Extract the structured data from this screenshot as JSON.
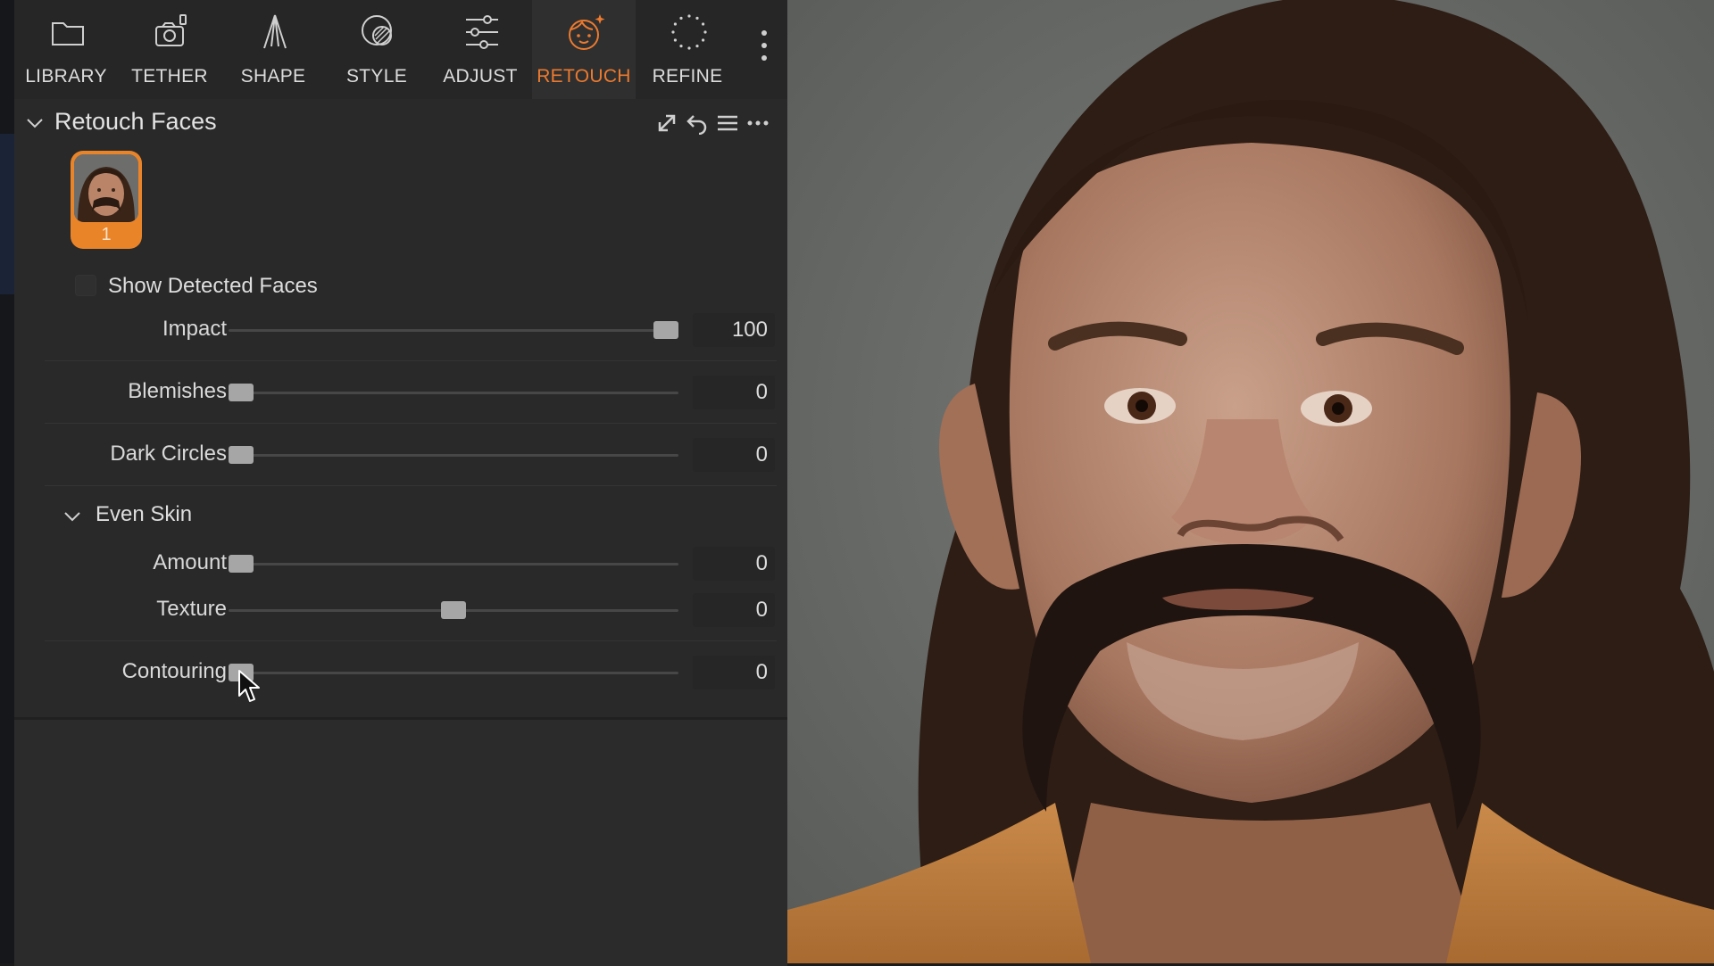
{
  "toolbar": {
    "tools": [
      {
        "label": "LIBRARY",
        "icon": "folder-icon",
        "active": false
      },
      {
        "label": "TETHER",
        "icon": "camera-icon",
        "active": false
      },
      {
        "label": "SHAPE",
        "icon": "shape-icon",
        "active": false
      },
      {
        "label": "STYLE",
        "icon": "style-icon",
        "active": false
      },
      {
        "label": "ADJUST",
        "icon": "adjust-sliders-icon",
        "active": false
      },
      {
        "label": "RETOUCH",
        "icon": "retouch-face-icon",
        "active": true
      },
      {
        "label": "REFINE",
        "icon": "refine-icon",
        "active": false
      }
    ],
    "active_color": "#ec7a2f"
  },
  "section": {
    "title": "Retouch Faces",
    "header_icons": [
      "expand-icon",
      "reset-icon",
      "list-icon",
      "more-icon"
    ]
  },
  "faces": [
    {
      "index": "1"
    }
  ],
  "show_detected_faces": {
    "label": "Show Detected Faces",
    "checked": false
  },
  "sliders": {
    "impact": {
      "label": "Impact",
      "value": "100",
      "fraction": 1.0
    },
    "blemishes": {
      "label": "Blemishes",
      "value": "0",
      "fraction": 0.0
    },
    "dark_circles": {
      "label": "Dark Circles",
      "value": "0",
      "fraction": 0.0
    }
  },
  "even_skin": {
    "title": "Even Skin",
    "sliders": {
      "amount": {
        "label": "Amount",
        "value": "0",
        "fraction": 0.0
      },
      "texture": {
        "label": "Texture",
        "value": "0",
        "fraction": 0.5
      }
    }
  },
  "contouring": {
    "label": "Contouring",
    "value": "0",
    "fraction": 0.0
  }
}
